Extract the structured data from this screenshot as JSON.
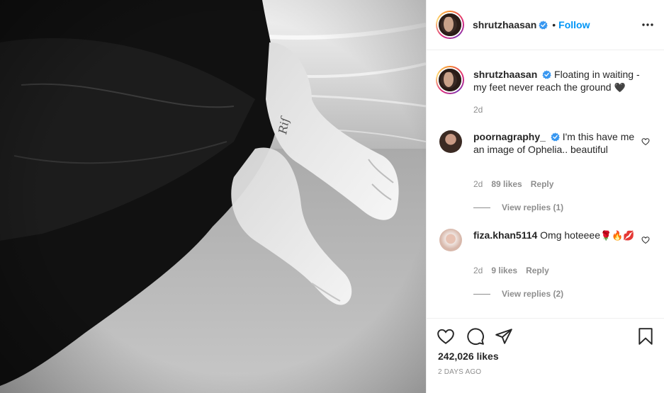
{
  "post": {
    "author": "shrutzhaasan",
    "follow_label": "Follow",
    "separator": "•"
  },
  "caption": {
    "username": "shrutzhaasan",
    "text": "Floating in waiting - my feet never reach the ground",
    "emoji": "🖤",
    "time": "2d"
  },
  "comments": [
    {
      "username": "poornagraphy_",
      "text": "I'm this have me an image of Ophelia.. beautiful",
      "time": "2d",
      "likes": "89 likes",
      "reply_label": "Reply",
      "view_replies": "View replies (1)"
    },
    {
      "username": "fiza.khan5114",
      "text": "Omg hoteeee",
      "emoji": "🌹🔥💋",
      "time": "2d",
      "likes": "9 likes",
      "reply_label": "Reply",
      "view_replies": "View replies (2)"
    }
  ],
  "footer": {
    "likes": "242,026 likes",
    "timestamp": "2 DAYS AGO"
  },
  "icons": {
    "like": "heart-icon",
    "comment": "comment-bubble-icon",
    "share": "paper-plane-icon",
    "save": "bookmark-icon",
    "more": "more-options-icon",
    "verified": "verified-badge-icon"
  },
  "colors": {
    "accent": "#0095f6",
    "verified": "#3897f0",
    "text": "#262626",
    "muted": "#8e8e8e",
    "border": "#efefef"
  }
}
